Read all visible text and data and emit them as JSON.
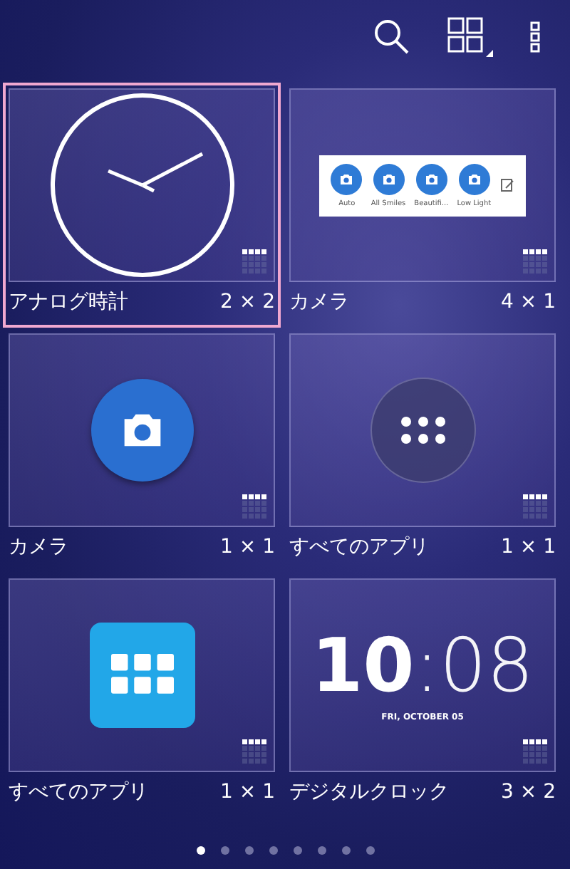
{
  "widget_rows": [
    {
      "widgets": [
        {
          "kind": "analog_clock",
          "name": "アナログ時計",
          "size": "2 × 2",
          "selected": true
        },
        {
          "kind": "camera_strip",
          "name": "カメラ",
          "size": "4 × 1",
          "selected": false,
          "modes": [
            "Auto",
            "All Smiles",
            "Beautifi...",
            "Low Light"
          ]
        }
      ]
    },
    {
      "widgets": [
        {
          "kind": "camera_button",
          "name": "カメラ",
          "size": "1 × 1",
          "selected": false
        },
        {
          "kind": "apps_circle",
          "name": "すべてのアプリ",
          "size": "1 × 1",
          "selected": false
        }
      ]
    },
    {
      "widgets": [
        {
          "kind": "apps_square",
          "name": "すべてのアプリ",
          "size": "1 × 1",
          "selected": false
        },
        {
          "kind": "digital_clock",
          "name": "デジタルクロック",
          "size": "3 × 2",
          "selected": false,
          "hour": "10",
          "minute": ":08",
          "date": "FRI, OCTOBER 05"
        }
      ]
    }
  ],
  "pages": [
    {
      "selected": true
    },
    {
      "selected": false
    },
    {
      "selected": false
    },
    {
      "selected": false
    },
    {
      "selected": false
    },
    {
      "selected": false
    },
    {
      "selected": false
    },
    {
      "selected": false
    }
  ]
}
